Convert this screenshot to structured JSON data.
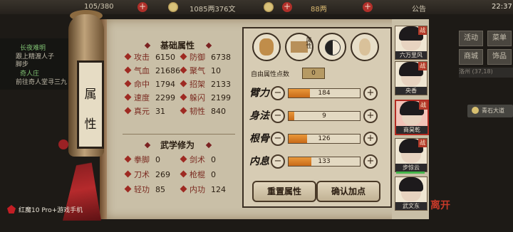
{
  "topbar": {
    "clock": "22:37",
    "resource1": "105/380",
    "resource2": "1085两376文",
    "resource3": "88两",
    "announce": "公告"
  },
  "quest_log": {
    "line1": "长夜难明",
    "line2": "跟上精渡人子",
    "line3": "脚步",
    "line4": "奇人庄",
    "line5": "前往奇人堂寻三九"
  },
  "background_buttons": {
    "huodong": "活动",
    "shezhi": "菜单",
    "shangcheng": "商城",
    "shipin": "饰品",
    "location": "洛州 (37,18)",
    "go_button": "青石大道"
  },
  "scroll_title": [
    "属",
    "性"
  ],
  "basic_attrs": {
    "header": "基础属性",
    "items": [
      {
        "label": "攻击",
        "value": "6150"
      },
      {
        "label": "防御",
        "value": "6738"
      },
      {
        "label": "气血",
        "value": "21686"
      },
      {
        "label": "聚气",
        "value": "10"
      },
      {
        "label": "命中",
        "value": "1794"
      },
      {
        "label": "招架",
        "value": "2133"
      },
      {
        "label": "速度",
        "value": "2299"
      },
      {
        "label": "躲闪",
        "value": "2199"
      },
      {
        "label": "真元",
        "value": "31"
      },
      {
        "label": "韧性",
        "value": "840"
      }
    ]
  },
  "martial": {
    "header": "武学修为",
    "items": [
      {
        "label": "拳脚",
        "value": "0"
      },
      {
        "label": "剑术",
        "value": "0"
      },
      {
        "label": "刀术",
        "value": "269"
      },
      {
        "label": "枪棍",
        "value": "0"
      },
      {
        "label": "轻功",
        "value": "85"
      },
      {
        "label": "内功",
        "value": "124"
      }
    ]
  },
  "attr_icons": {
    "middle_tag": "属性"
  },
  "free_points": {
    "label": "自由属性点数",
    "value": "0"
  },
  "allocations": [
    {
      "label": "臂力",
      "value": "184",
      "fraction": 0.3
    },
    {
      "label": "身法",
      "value": "9",
      "fraction": 0.08
    },
    {
      "label": "根骨",
      "value": "126",
      "fraction": 0.26
    },
    {
      "label": "内息",
      "value": "133",
      "fraction": 0.32
    }
  ],
  "buttons": {
    "reset": "重置属性",
    "confirm": "确认加点"
  },
  "heroes": [
    {
      "name": "六万里风",
      "tag": "战"
    },
    {
      "name": "央香",
      "tag": "战"
    },
    {
      "name": "商昊乾",
      "tag": "战"
    },
    {
      "name": "步惊云",
      "tag": "战"
    },
    {
      "name": "武文东",
      "tag": ""
    }
  ],
  "corner_logo": "离开",
  "phone_watermark": "红魔10 Pro+游戏手机"
}
